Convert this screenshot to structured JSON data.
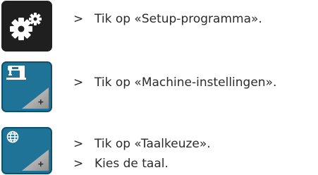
{
  "steps": [
    {
      "bullet": ">",
      "text": "Tik op «Setup-programma»."
    },
    {
      "bullet": ">",
      "text": "Tik op «Machine-instellingen»."
    },
    {
      "bullet": ">",
      "text": "Tik op «Taalkeuze»."
    },
    {
      "bullet": ">",
      "text": "Kies de taal."
    }
  ],
  "icons": {
    "setup": "gears-icon",
    "machine": "sewing-machine-icon",
    "language": "globe-icon",
    "expand": "plus-icon"
  },
  "colors": {
    "setup_button": "#1f1f1f",
    "settings_button": "#1f7397",
    "text": "#2b2b2b"
  }
}
